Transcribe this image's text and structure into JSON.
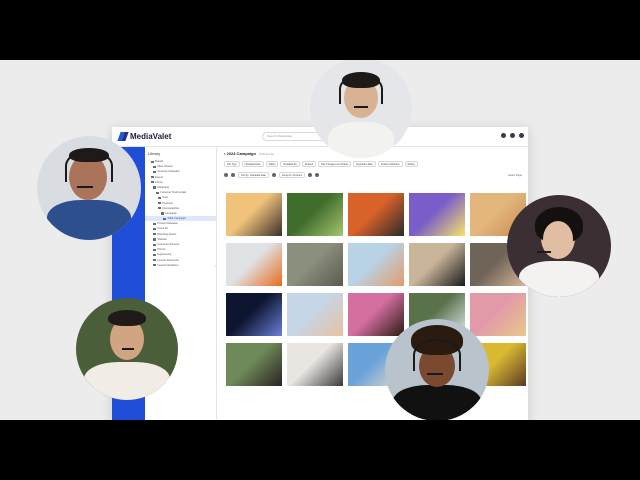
{
  "app": {
    "brand": "MediaValet",
    "search_placeholder": "Search MediaValet",
    "accent": "#1f4ed8"
  },
  "tree": {
    "title": "Library",
    "items": [
      {
        "label": "Brands",
        "indent": 1
      },
      {
        "label": "Most Viewed",
        "indent": 2
      },
      {
        "label": "Recently Uploaded",
        "indent": 2
      },
      {
        "label": "Events",
        "indent": 1
      },
      {
        "label": "Library",
        "indent": 1
      },
      {
        "label": "Marketing",
        "indent": 2
      },
      {
        "label": "Customer Testimonials",
        "indent": 3
      },
      {
        "label": "Past",
        "indent": 4
      },
      {
        "label": "Products",
        "indent": 4
      },
      {
        "label": "Demographics",
        "indent": 4
      },
      {
        "label": "Campaign",
        "indent": 5
      },
      {
        "label": "2024 Campaign",
        "indent": 6,
        "selected": true
      },
      {
        "label": "Product Releases",
        "indent": 2
      },
      {
        "label": "Press Kit",
        "indent": 2
      },
      {
        "label": "Branding Assets",
        "indent": 2
      },
      {
        "label": "Website",
        "indent": 2
      },
      {
        "label": "Customer Success",
        "indent": 2
      },
      {
        "label": "Photos",
        "indent": 2
      },
      {
        "label": "Engineering",
        "indent": 2
      },
      {
        "label": "Human Resources",
        "indent": 2
      },
      {
        "label": "Investor Relations",
        "indent": 2
      }
    ]
  },
  "content": {
    "folder_title": "2024 Campaign",
    "folder_count": "(100 items)",
    "filters": [
      "File Type",
      "Uploaded Date",
      "Status",
      "Metadata By",
      "Deleted",
      "Has # Images and Videos",
      "Expiration Date",
      "Custom Attributes",
      "Rating"
    ],
    "sort_label": "Sort by: Uploaded Date",
    "group_label": "Group by: All Items",
    "select_page": "Select Page"
  },
  "thumbnails": [
    {
      "c1": "#f0c27a",
      "c2": "#3a2f2a",
      "name": "airplane-window-photo"
    },
    {
      "c1": "#3f6d2c",
      "c2": "#a5c46e",
      "name": "green-hills-photo"
    },
    {
      "c1": "#d9622a",
      "c2": "#2a2a2a",
      "name": "woman-reading-photo"
    },
    {
      "c1": "#7a5dc8",
      "c2": "#f5e36b",
      "name": "chameleon-photo"
    },
    {
      "c1": "#e3b77c",
      "c2": "#c98a4e",
      "name": "sand-dunes-photo"
    },
    {
      "c1": "#dfe3e6",
      "c2": "#e86c1e",
      "name": "orange-chair-photo"
    },
    {
      "c1": "#8b8f7e",
      "c2": "#5a5a4e",
      "name": "friends-bench-photo"
    },
    {
      "c1": "#b8d2e6",
      "c2": "#e39c6a",
      "name": "basketball-hoop-photo"
    },
    {
      "c1": "#c9b59a",
      "c2": "#1a1a1a",
      "name": "graduate-photo"
    },
    {
      "c1": "#6f6458",
      "c2": "#d8b69a",
      "name": "friends-laughing-photo"
    },
    {
      "c1": "#0d1530",
      "c2": "#6b7fd8",
      "name": "welder-sparks-photo"
    },
    {
      "c1": "#c7d6e6",
      "c2": "#e5c2a2",
      "name": "woman-phone-photo"
    },
    {
      "c1": "#d46fa0",
      "c2": "#2a1a14",
      "name": "curly-hair-woman-photo"
    },
    {
      "c1": "#59724a",
      "c2": "#dfe7e9",
      "name": "waterfall-photo"
    },
    {
      "c1": "#e39aa8",
      "c2": "#e8c88c",
      "name": "bearded-man-photo"
    },
    {
      "c1": "#6f8a5a",
      "c2": "#2a2220",
      "name": "woman-profile-photo"
    },
    {
      "c1": "#e9e6e2",
      "c2": "#3a3a3a",
      "name": "tablet-coffee-photo"
    },
    {
      "c1": "#6aa3d9",
      "c2": "#e6dcc9",
      "name": "coastal-town-photo"
    },
    {
      "c1": "#c4a88a",
      "c2": "#2a2520",
      "name": "woman-headset-photo"
    },
    {
      "c1": "#d9b832",
      "c2": "#5a3a24",
      "name": "man-yellow-photo"
    }
  ]
}
